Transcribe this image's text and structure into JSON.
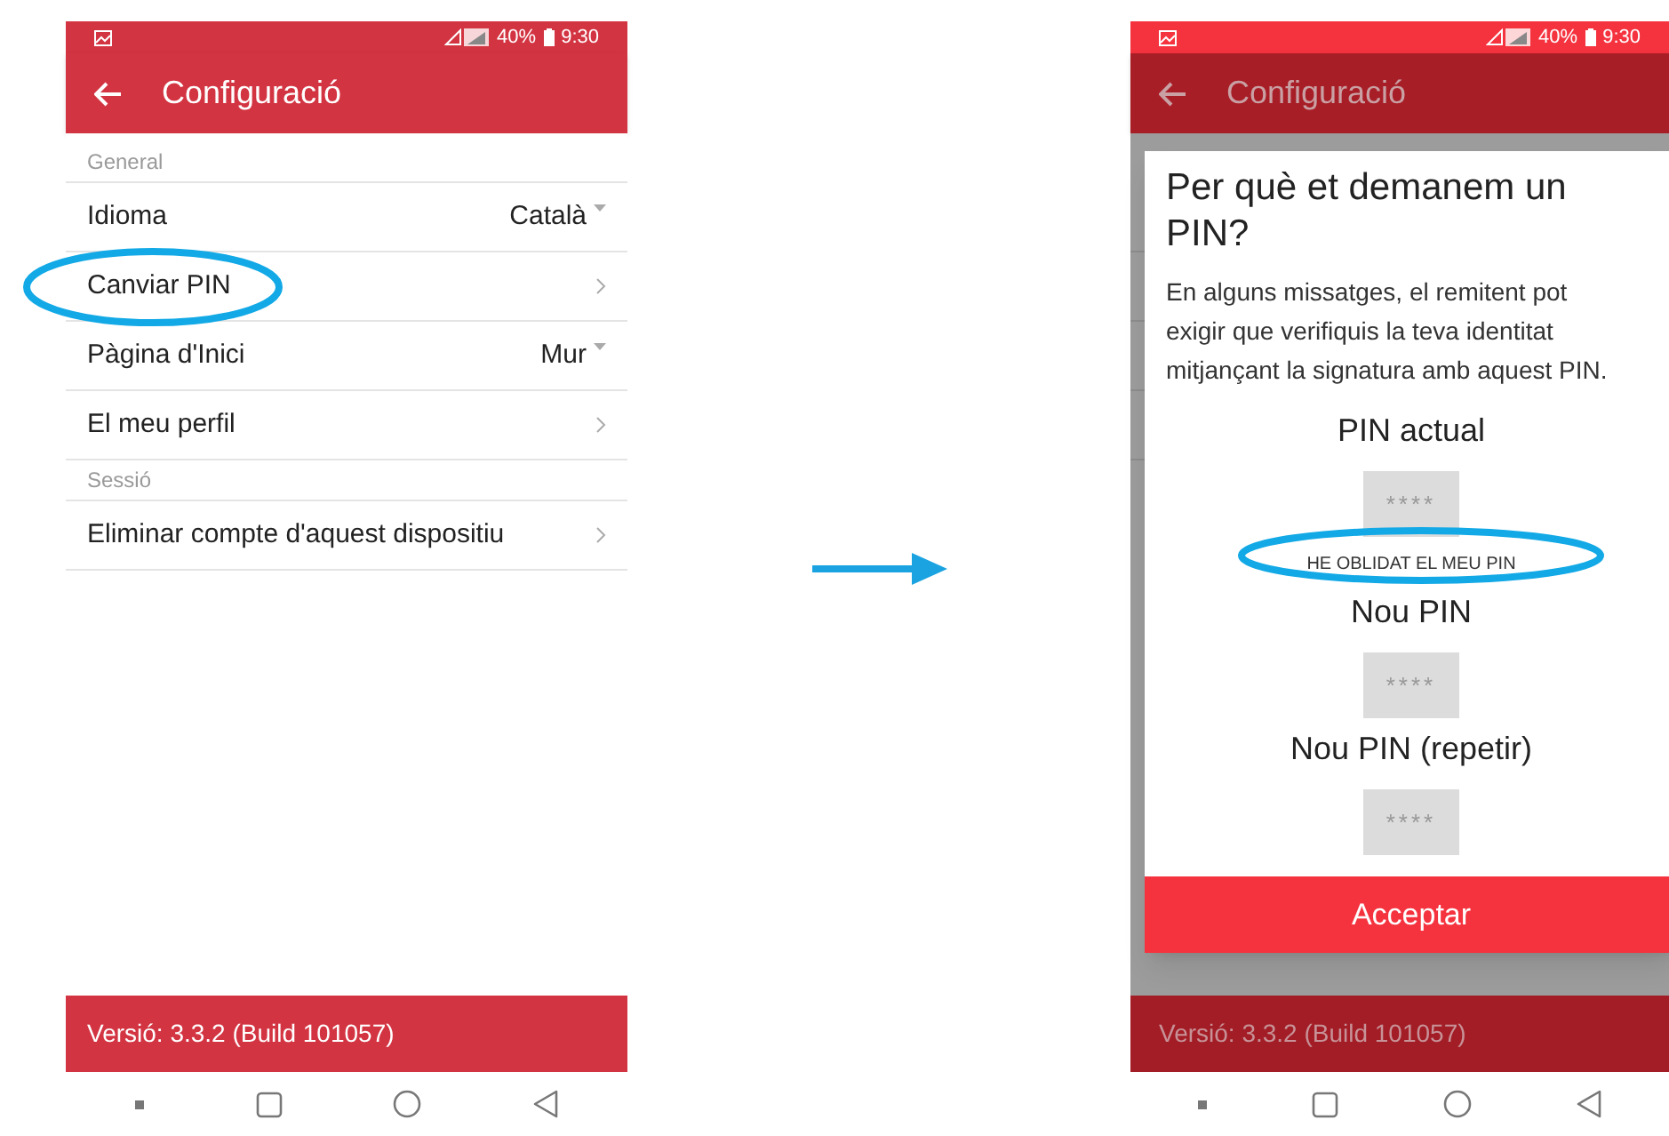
{
  "settings_screen": {
    "status_bar": {
      "battery": "40%",
      "time": "9:30"
    },
    "toolbar": {
      "title": "Configuració"
    },
    "items": [
      {
        "kind": "header",
        "label": "General"
      },
      {
        "kind": "select",
        "label": "Idioma",
        "value": "Català"
      },
      {
        "kind": "link",
        "label": "Canviar PIN"
      },
      {
        "kind": "select",
        "label": "Pàgina d'Inici",
        "value": "Mur"
      },
      {
        "kind": "link",
        "label": "El meu perfil"
      },
      {
        "kind": "header",
        "label": "Sessió"
      },
      {
        "kind": "link",
        "label": "Eliminar compte d'aquest dispositiu"
      }
    ],
    "footer": "Versió: 3.3.2 (Build 101057)"
  },
  "pin_dialog_screen": {
    "status_bar": {
      "battery": "40%",
      "time": "9:30"
    },
    "toolbar": {
      "title": "Configuració"
    },
    "dialog": {
      "title": "Per què et demanem un PIN?",
      "body": "En alguns missatges, el remitent pot exigir que verifiquis la teva identitat mitjançant la signatura amb aquest PIN.",
      "fields": [
        {
          "label": "PIN actual",
          "placeholder": "****"
        },
        {
          "label": "Nou PIN",
          "placeholder": "****"
        },
        {
          "label": "Nou PIN (repetir)",
          "placeholder": "****"
        }
      ],
      "forgot_button": "HE OBLIDAT EL MEU PIN",
      "accept_button": "Acceptar"
    },
    "footer": "Versió: 3.3.2 (Build 101057)"
  }
}
